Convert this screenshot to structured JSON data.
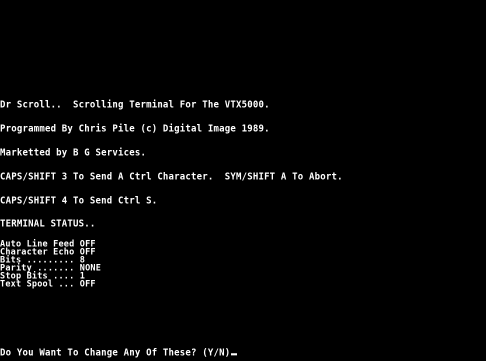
{
  "terminal": {
    "header_lines": [
      "Dr Scroll..  Scrolling Terminal For The VTX5000.",
      "Programmed By Chris Pile (c) Digital Image 1989.",
      "Marketted by B G Services.",
      "CAPS/SHIFT 3 To Send A Ctrl Character.  SYM/SHIFT A To Abort.",
      "CAPS/SHIFT 4 To Send Ctrl S.",
      "TERMINAL STATUS.."
    ],
    "status_lines": [
      "Auto Line Feed OFF",
      "Character Echo OFF",
      "Bits ......... 8",
      "Parity ....... NONE",
      "Stop Bits .... 1",
      "Text Spool ... OFF"
    ],
    "prompt": "Do You Want To Change Any Of These? (Y/N)"
  },
  "colors": {
    "background": "#000000",
    "foreground": "#ffffff"
  }
}
